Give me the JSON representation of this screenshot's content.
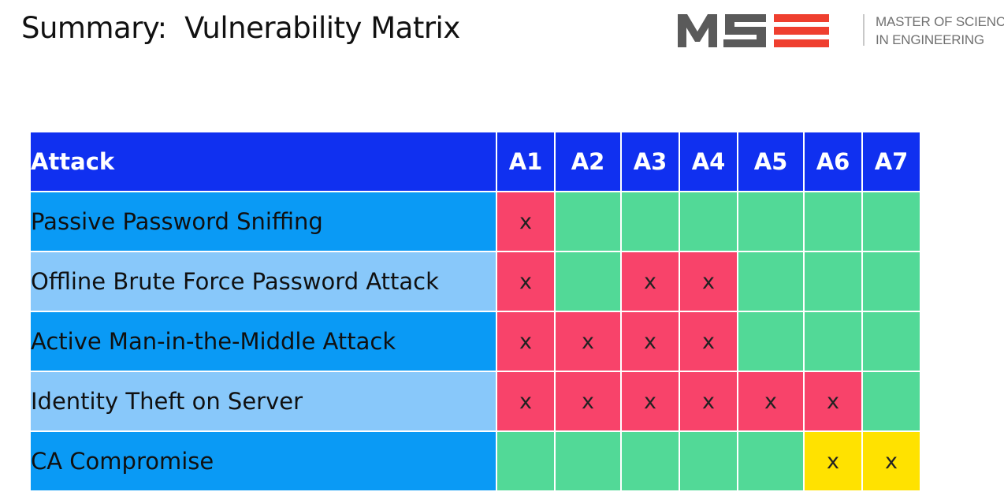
{
  "slide": {
    "title": "Summary:  Vulnerability Matrix",
    "logo": {
      "mark": "MSE",
      "line1": "MASTER OF SCIENCE",
      "line2": "IN ENGINEERING",
      "colors": {
        "gray": "#5a5a5a",
        "accent": "#ef3f2f"
      }
    }
  },
  "matrix": {
    "header": {
      "attack": "Attack",
      "columns": [
        "A1",
        "A2",
        "A3",
        "A4",
        "A5",
        "A6",
        "A7"
      ]
    },
    "colors": {
      "header_bg": "#1030f0",
      "row_dark": "#0a9af5",
      "row_light": "#88c8fa",
      "safe": "#52d997",
      "vulnerable": "#f8436a",
      "warning": "#ffe200"
    },
    "rows": [
      {
        "label": "Passive Password Sniffing",
        "cells": [
          {
            "mark": "x",
            "status": "red"
          },
          {
            "mark": "",
            "status": "green"
          },
          {
            "mark": "",
            "status": "green"
          },
          {
            "mark": "",
            "status": "green"
          },
          {
            "mark": "",
            "status": "green"
          },
          {
            "mark": "",
            "status": "green"
          },
          {
            "mark": "",
            "status": "green"
          }
        ]
      },
      {
        "label": "Offline Brute Force Password Attack",
        "cells": [
          {
            "mark": "x",
            "status": "red"
          },
          {
            "mark": "",
            "status": "green"
          },
          {
            "mark": "x",
            "status": "red"
          },
          {
            "mark": "x",
            "status": "red"
          },
          {
            "mark": "",
            "status": "green"
          },
          {
            "mark": "",
            "status": "green"
          },
          {
            "mark": "",
            "status": "green"
          }
        ]
      },
      {
        "label": "Active Man-in-the-Middle Attack",
        "cells": [
          {
            "mark": "x",
            "status": "red"
          },
          {
            "mark": "x",
            "status": "red"
          },
          {
            "mark": "x",
            "status": "red"
          },
          {
            "mark": "x",
            "status": "red"
          },
          {
            "mark": "",
            "status": "green"
          },
          {
            "mark": "",
            "status": "green"
          },
          {
            "mark": "",
            "status": "green"
          }
        ]
      },
      {
        "label": "Identity Theft on Server",
        "cells": [
          {
            "mark": "x",
            "status": "red"
          },
          {
            "mark": "x",
            "status": "red"
          },
          {
            "mark": "x",
            "status": "red"
          },
          {
            "mark": "x",
            "status": "red"
          },
          {
            "mark": "x",
            "status": "red"
          },
          {
            "mark": "x",
            "status": "red"
          },
          {
            "mark": "",
            "status": "green"
          }
        ]
      },
      {
        "label": "CA Compromise",
        "cells": [
          {
            "mark": "",
            "status": "green"
          },
          {
            "mark": "",
            "status": "green"
          },
          {
            "mark": "",
            "status": "green"
          },
          {
            "mark": "",
            "status": "green"
          },
          {
            "mark": "",
            "status": "green"
          },
          {
            "mark": "x",
            "status": "yellow"
          },
          {
            "mark": "x",
            "status": "yellow"
          }
        ]
      }
    ]
  }
}
